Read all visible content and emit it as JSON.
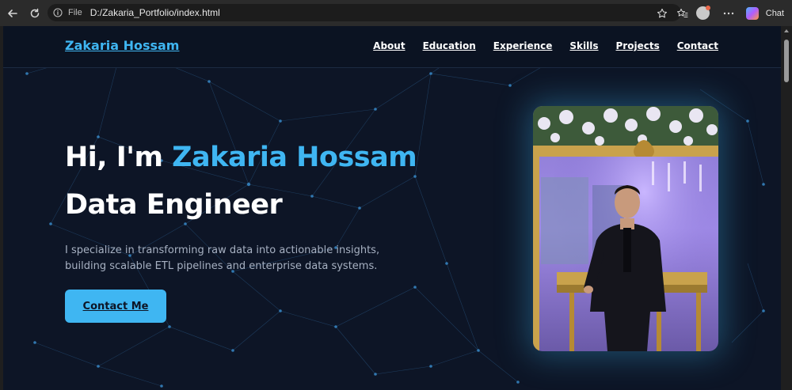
{
  "browser": {
    "file_label": "File",
    "url": "D:/Zakaria_Portfolio/index.html",
    "chat_label": "Chat",
    "icons": [
      "back-icon",
      "refresh-icon",
      "info-icon",
      "star-icon",
      "favorites-icon",
      "profile-icon",
      "more-icon",
      "copilot-icon"
    ]
  },
  "site": {
    "brand": "Zakaria Hossam",
    "nav": [
      "About",
      "Education",
      "Experience",
      "Skills",
      "Projects",
      "Contact"
    ]
  },
  "hero": {
    "greeting": "Hi, I'm ",
    "name": "Zakaria Hossam",
    "role": "Data Engineer",
    "description": "I specialize in transforming raw data into actionable insights, building scalable ETL pipelines and enterprise data systems.",
    "cta": "Contact Me"
  },
  "colors": {
    "accent": "#3fb6f2",
    "background": "#0d1526",
    "text": "#ffffff",
    "muted": "#a7b1c2"
  }
}
